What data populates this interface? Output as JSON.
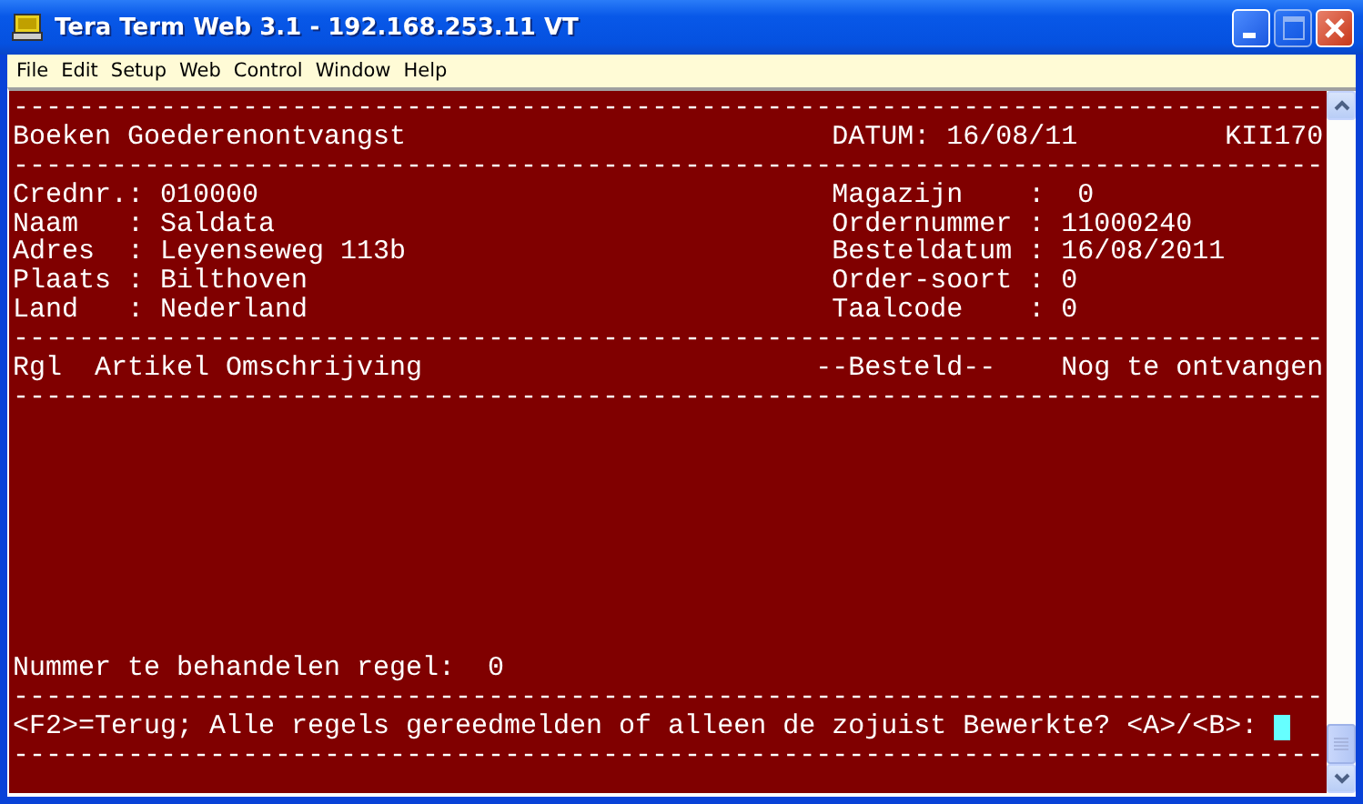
{
  "window": {
    "title": "Tera Term Web 3.1 - 192.168.253.11 VT",
    "maximize_disabled": true
  },
  "menu": [
    "File",
    "Edit",
    "Setup",
    "Web",
    "Control",
    "Window",
    "Help"
  ],
  "terminal": {
    "top_lines": [
      {
        "text": "--------------------------------------------------------------------------------",
        "cursor": false
      },
      {
        "text": "Boeken Goederenontvangst                          DATUM: 16/08/11         KII170",
        "cursor": false
      },
      {
        "text": "--------------------------------------------------------------------------------",
        "cursor": false
      },
      {
        "text": "Crednr.: 010000                                   Magazijn    :  0",
        "cursor": false
      },
      {
        "text": "Naam   : Saldata                                  Ordernummer : 11000240",
        "cursor": false
      },
      {
        "text": "Adres  : Leyenseweg 113b                          Besteldatum : 16/08/2011",
        "cursor": false
      },
      {
        "text": "Plaats : Bilthoven                                Order-soort : 0",
        "cursor": false
      },
      {
        "text": "Land   : Nederland                                Taalcode    : 0",
        "cursor": false
      },
      {
        "text": "--------------------------------------------------------------------------------",
        "cursor": false
      },
      {
        "text": "Rgl  Artikel Omschrijving                        --Besteld--    Nog te ontvangen",
        "cursor": false
      },
      {
        "text": "--------------------------------------------------------------------------------",
        "cursor": false
      }
    ],
    "bottom_lines": [
      {
        "text": "Nummer te behandelen regel:  0",
        "cursor": false
      },
      {
        "text": "--------------------------------------------------------------------------------",
        "cursor": false
      },
      {
        "text": "<F2>=Terug; Alle regels gereedmelden of alleen de zojuist Bewerkte? <A>/<B>: ",
        "cursor": true
      },
      {
        "text": "--------------------------------------------------------------------------------",
        "cursor": false
      }
    ]
  }
}
